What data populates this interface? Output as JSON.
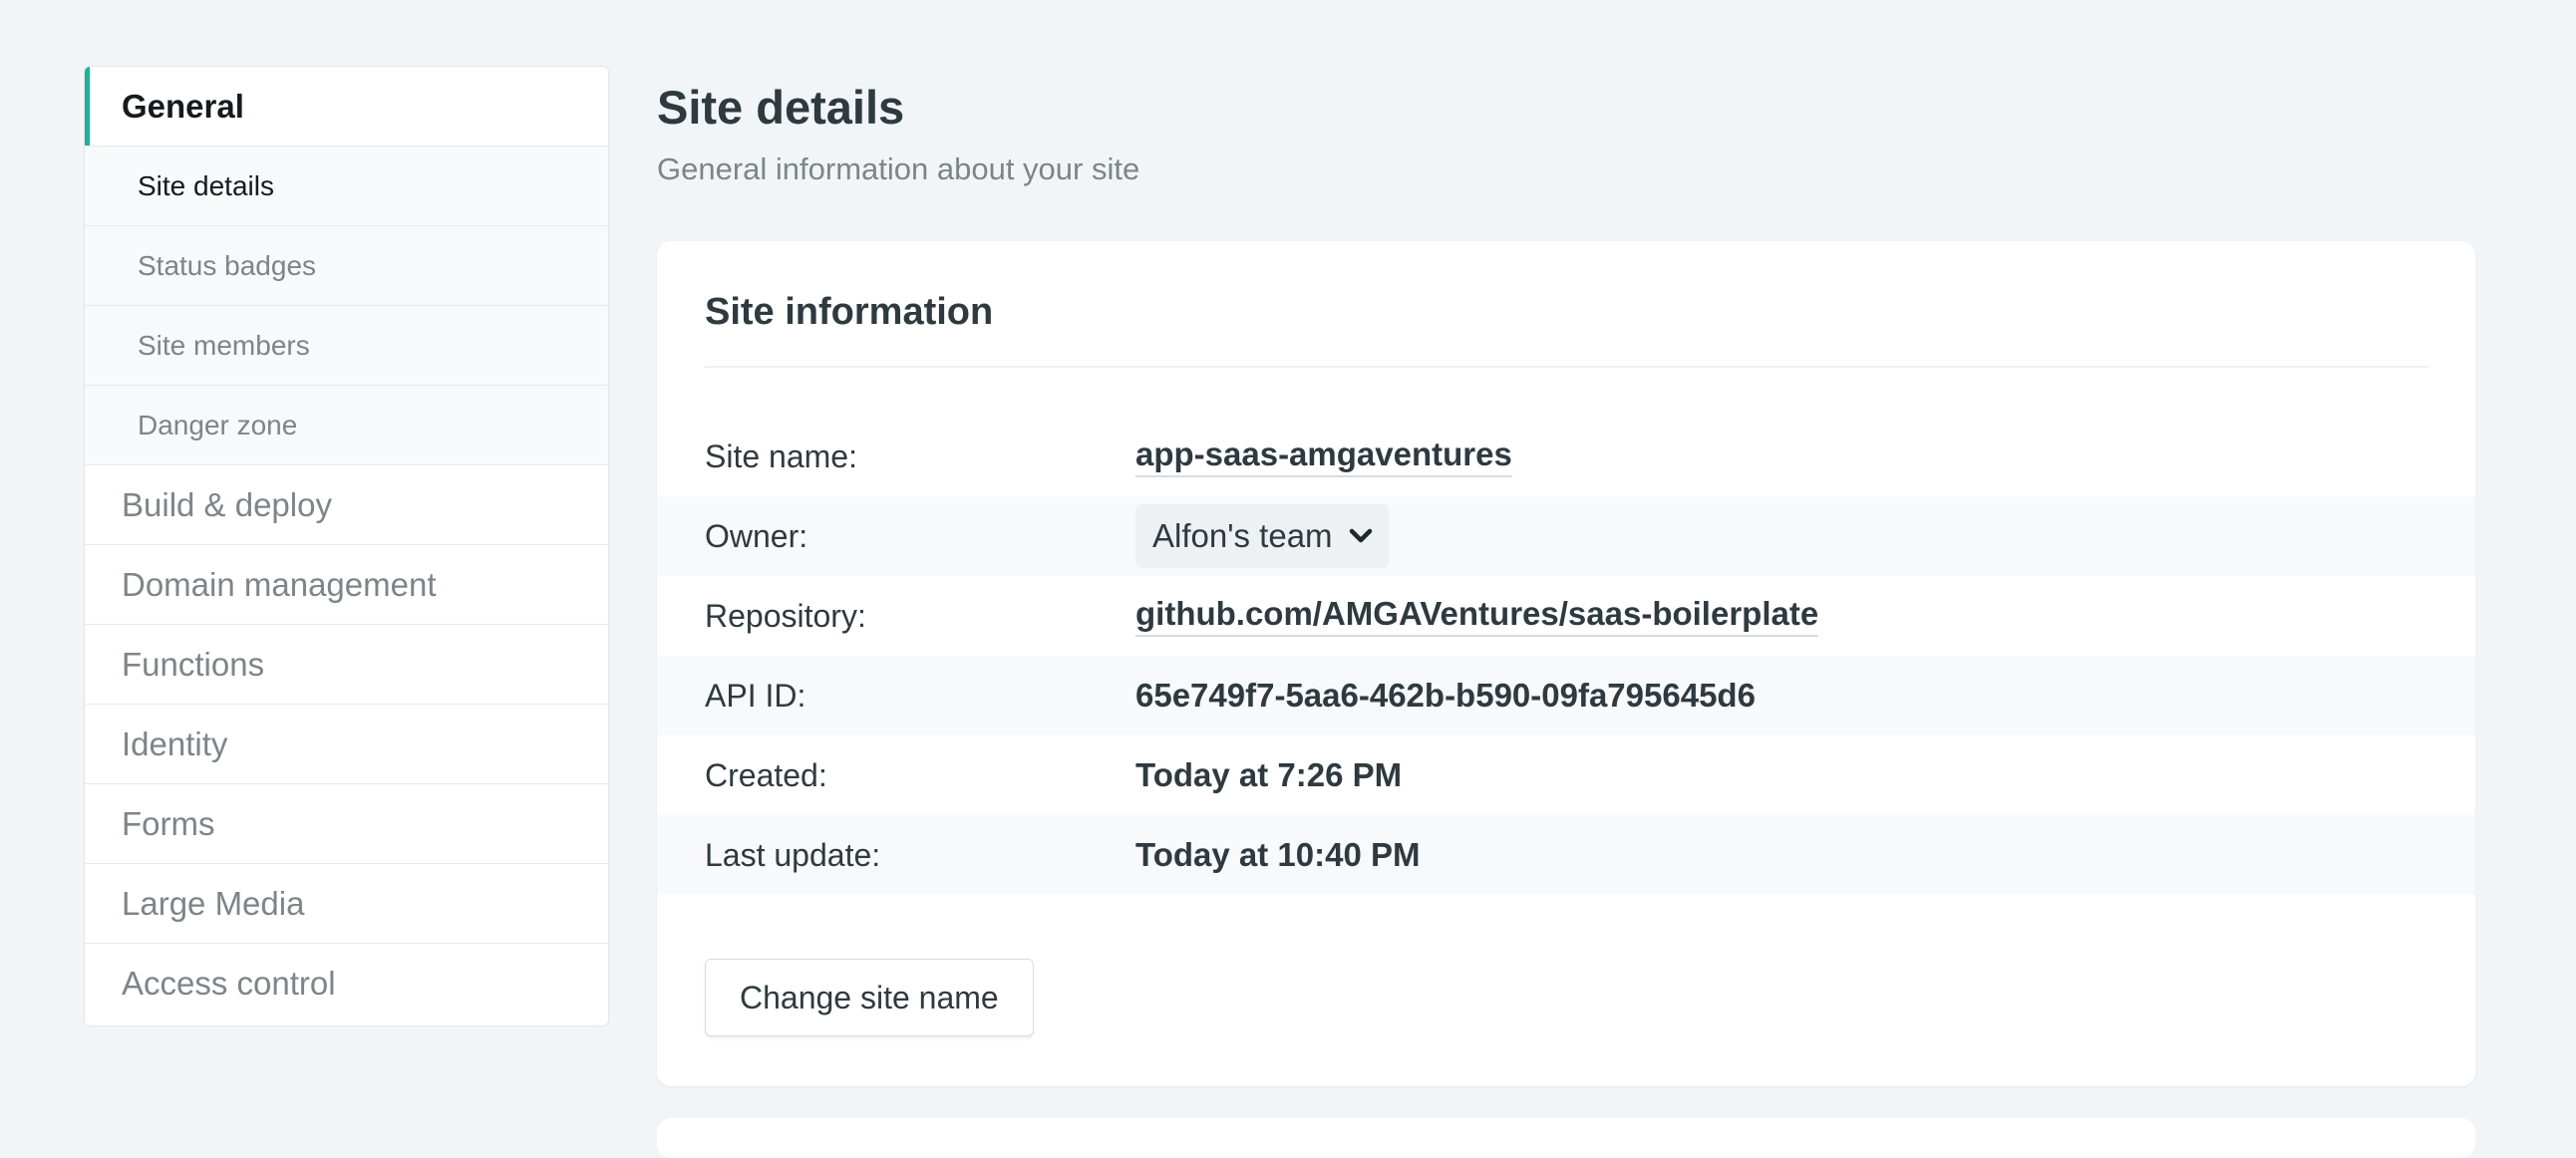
{
  "sidebar": {
    "general": "General",
    "sub_items": [
      "Site details",
      "Status badges",
      "Site members",
      "Danger zone"
    ],
    "items": [
      "Build & deploy",
      "Domain management",
      "Functions",
      "Identity",
      "Forms",
      "Large Media",
      "Access control"
    ]
  },
  "page": {
    "title": "Site details",
    "subtitle": "General information about your site"
  },
  "card": {
    "title": "Site information",
    "rows": {
      "site_name": {
        "label": "Site name:",
        "value": "app-saas-amgaventures"
      },
      "owner": {
        "label": "Owner:",
        "value": "Alfon's team"
      },
      "repository": {
        "label": "Repository:",
        "value": "github.com/AMGAVentures/saas-boilerplate"
      },
      "api_id": {
        "label": "API ID:",
        "value": "65e749f7-5aa6-462b-b590-09fa795645d6"
      },
      "created": {
        "label": "Created:",
        "value": "Today at 7:26 PM"
      },
      "last_update": {
        "label": "Last update:",
        "value": "Today at 10:40 PM"
      }
    },
    "change_button": "Change site name"
  },
  "colors": {
    "accent": "#15b5a0",
    "background": "#f2f5f8"
  }
}
